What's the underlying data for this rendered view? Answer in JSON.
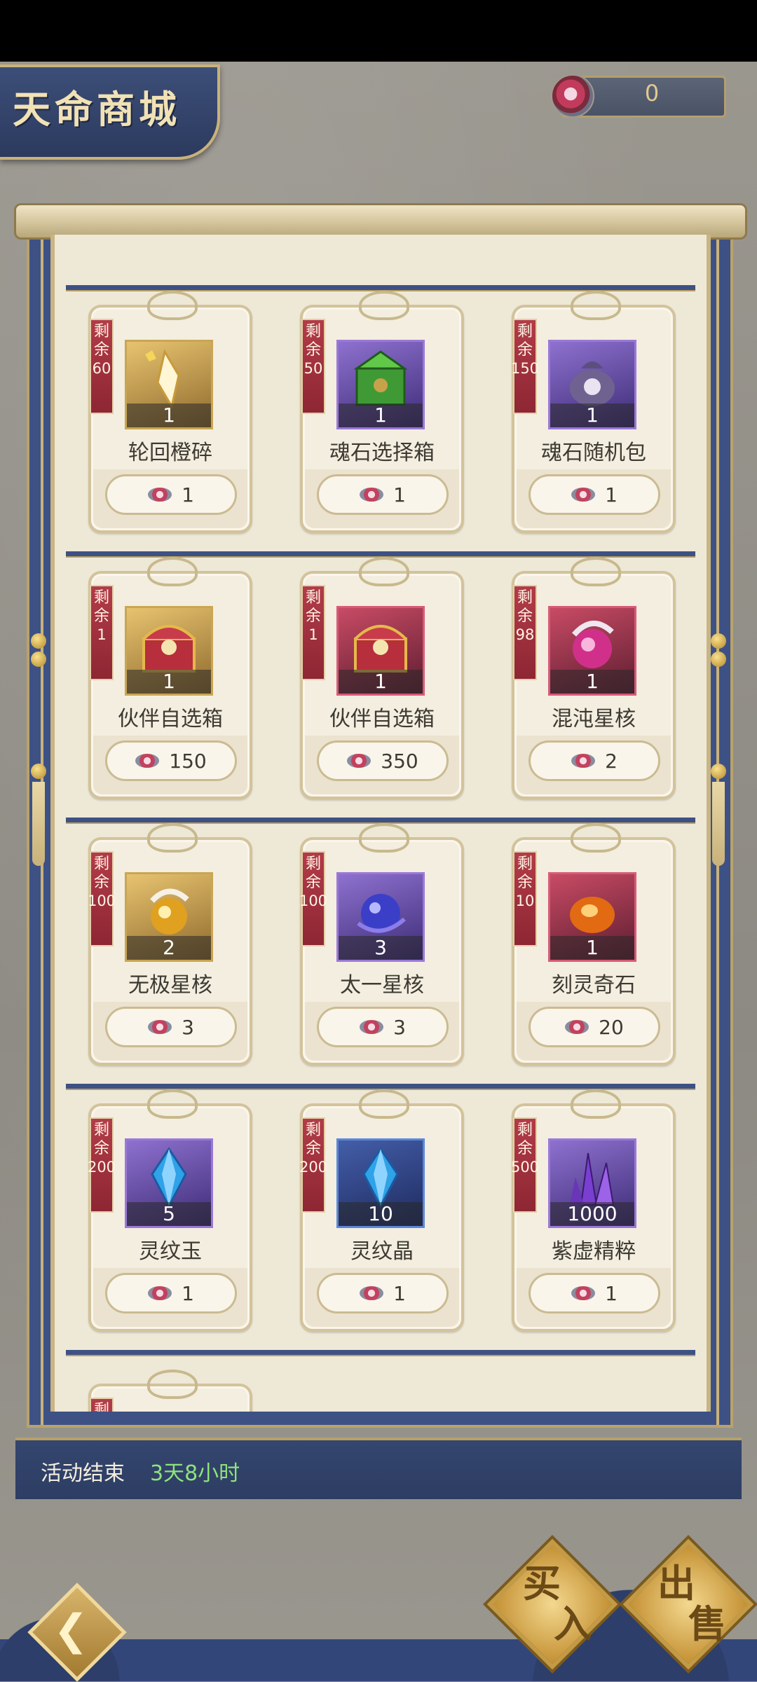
{
  "header": {
    "title": "天命商城",
    "currency_value": "0",
    "currency_icon": "spirit-coin-icon"
  },
  "shop": {
    "remaining_label_top": "剩",
    "remaining_label_bottom": "余",
    "items": [
      {
        "remaining": "60",
        "qty": "1",
        "name": "轮回橙碎",
        "price": "1",
        "frame": "gold",
        "icon": "orange-fragment-icon"
      },
      {
        "remaining": "50",
        "qty": "1",
        "name": "魂石选择箱",
        "price": "1",
        "frame": "purple",
        "icon": "green-chest-icon"
      },
      {
        "remaining": "150",
        "qty": "1",
        "name": "魂石随机包",
        "price": "1",
        "frame": "purple",
        "icon": "lucky-bag-icon"
      },
      {
        "remaining": "1",
        "qty": "1",
        "name": "伙伴自选箱",
        "price": "150",
        "frame": "gold",
        "icon": "treasure-chest-icon"
      },
      {
        "remaining": "1",
        "qty": "1",
        "name": "伙伴自选箱",
        "price": "350",
        "frame": "red",
        "icon": "treasure-chest-icon"
      },
      {
        "remaining": "98",
        "qty": "1",
        "name": "混沌星核",
        "price": "2",
        "frame": "red",
        "icon": "chaos-star-core-icon"
      },
      {
        "remaining": "100",
        "qty": "2",
        "name": "无极星核",
        "price": "3",
        "frame": "gold",
        "icon": "wuji-star-core-icon"
      },
      {
        "remaining": "100",
        "qty": "3",
        "name": "太一星核",
        "price": "3",
        "frame": "purple",
        "icon": "taiyi-star-core-icon"
      },
      {
        "remaining": "10",
        "qty": "1",
        "name": "刻灵奇石",
        "price": "20",
        "frame": "red",
        "icon": "spirit-stone-icon"
      },
      {
        "remaining": "200",
        "qty": "5",
        "name": "灵纹玉",
        "price": "1",
        "frame": "purple",
        "icon": "blue-crystal-icon"
      },
      {
        "remaining": "200",
        "qty": "10",
        "name": "灵纹晶",
        "price": "1",
        "frame": "blue",
        "icon": "blue-crystal-icon"
      },
      {
        "remaining": "500",
        "qty": "1000",
        "name": "紫虚精粹",
        "price": "1",
        "frame": "purple",
        "icon": "purple-crystal-icon"
      }
    ],
    "partial_ribbon": "剩"
  },
  "footer": {
    "event_label": "活动结束",
    "event_time": "3天8小时",
    "buy_label_1": "买",
    "buy_label_2": "入",
    "sell_label_1": "出",
    "sell_label_2": "售"
  }
}
